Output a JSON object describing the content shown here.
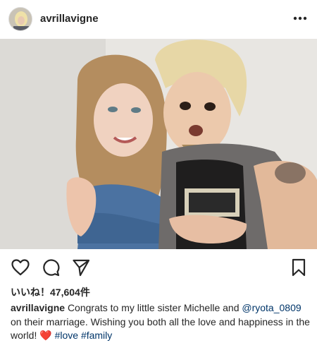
{
  "post": {
    "username": "avrillavigne",
    "photo_alt": "",
    "likes_label": "いいね！47,604件",
    "caption": {
      "username": "avrillavigne",
      "text_1": "Congrats to my little sister Michelle and",
      "mention": "@ryota_0809",
      "text_2": "on their marriage. Wishing you both all the love and happiness in the world!",
      "emoji": "❤️",
      "hashtag_1": "#love",
      "hashtag_2": "#family"
    }
  },
  "icons": {
    "more": "more-options-icon",
    "like": "heart-icon",
    "comment": "comment-icon",
    "share": "share-icon",
    "save": "bookmark-icon"
  },
  "colors": {
    "text": "#262626",
    "link": "#003569",
    "heart": "#e0245e"
  }
}
